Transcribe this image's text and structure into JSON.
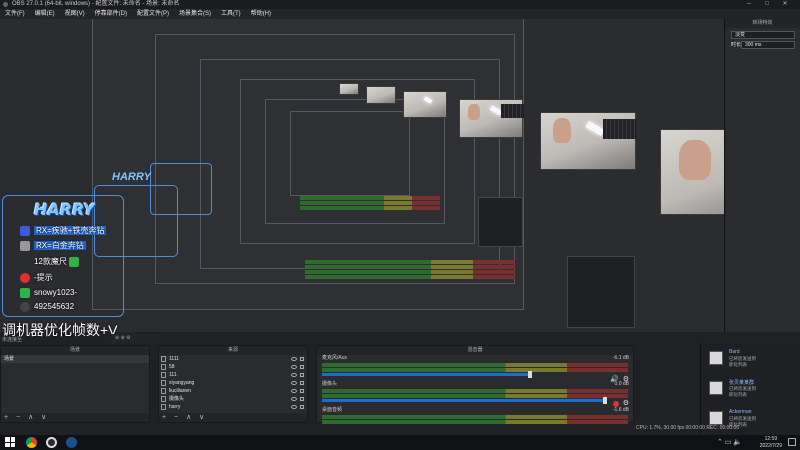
{
  "title": "OBS 27.0.1 (64-bit, windows) - 配置文件: 未命名 - 场景: 未命名",
  "menu": [
    "文件(F)",
    "编辑(E)",
    "视图(V)",
    "停靠部件(D)",
    "配置文件(P)",
    "场景集合(S)",
    "工具(T)",
    "帮助(H)"
  ],
  "sidebar": {
    "title": "转场特效",
    "mode": "淡变",
    "dur_label": "时长",
    "dur_value": "300 ms"
  },
  "overlay": {
    "logo": "HARRY",
    "rows": [
      "RX=疾驰+铁壳奔钻",
      "RX=白金奔钻",
      "12款魔尺",
      "-提示",
      "snowy1023-",
      "492545632"
    ],
    "caption": "调机器优化帧数+V",
    "sub": "未连接至"
  },
  "docks": {
    "scenes": "场景",
    "scene_item": "场景",
    "sources": "来源",
    "source_items": [
      "1111",
      "58",
      "111",
      "xiyangyang",
      "liucilianen",
      "摄像头",
      "harry"
    ],
    "mixer": "混音器",
    "mixer_tracks": [
      {
        "name": "麦克风/Aux",
        "db": "-6.1 dB"
      },
      {
        "name": "摄像头",
        "db": "0.0 dB"
      },
      {
        "name": "桌面音频",
        "db": "-1.6 dB"
      }
    ],
    "footer": "+ − ∧ ∨"
  },
  "chat": [
    {
      "name": "Bard",
      "l1": "已将您发送到",
      "l2": "即化列表"
    },
    {
      "name": "张贝某某群",
      "l1": "已将您发送到",
      "l2": "即化列表"
    },
    {
      "name": "Ackerman",
      "l1": "已将您发送到",
      "l2": "即化列表"
    }
  ],
  "stats": "CPU: 1.7%, 30.00 fps   00:00:00   REC: 00:00:00",
  "clock": {
    "time": "12:59",
    "date": "2022/7/29"
  },
  "colors": {
    "accent": "#1c6dd0",
    "overlay_blue": "#7fc3ff"
  }
}
